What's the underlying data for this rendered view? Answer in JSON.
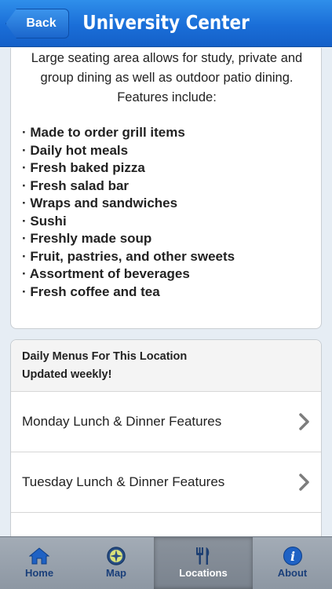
{
  "navbar": {
    "back_label": "Back",
    "title": "University Center"
  },
  "intro": {
    "lines": [
      "Large seating area allows for study, private and",
      "group dining as well as outdoor patio dining.",
      "Features include:"
    ]
  },
  "features": [
    "· Made to order grill items",
    "· Daily hot meals",
    "· Fresh baked pizza",
    "· Fresh salad bar",
    "· Wraps and sandwiches",
    "· Sushi",
    "· Freshly made soup",
    "· Fruit, pastries, and other sweets",
    "· Assortment of beverages",
    "· Fresh coffee and tea"
  ],
  "menus": {
    "header_line1": "Daily Menus For This Location",
    "header_line2": "Updated weekly!",
    "rows": [
      {
        "label": "Monday Lunch & Dinner Features",
        "icon": "chevron-right-icon"
      },
      {
        "label": "Tuesday Lunch & Dinner Features",
        "icon": "chevron-right-icon"
      },
      {
        "label": "",
        "icon": ""
      }
    ]
  },
  "tabbar": {
    "tabs": [
      {
        "label": "Home",
        "icon": "home-icon",
        "selected": false
      },
      {
        "label": "Map",
        "icon": "compass-icon",
        "selected": false
      },
      {
        "label": "Locations",
        "icon": "fork-knife-icon",
        "selected": true
      },
      {
        "label": "About",
        "icon": "info-icon",
        "selected": false
      }
    ]
  },
  "colors": {
    "navbar_blue": "#1a6ed8",
    "tab_label_blue": "#1a3f7a",
    "chevron_gray": "#7d7d7d"
  }
}
